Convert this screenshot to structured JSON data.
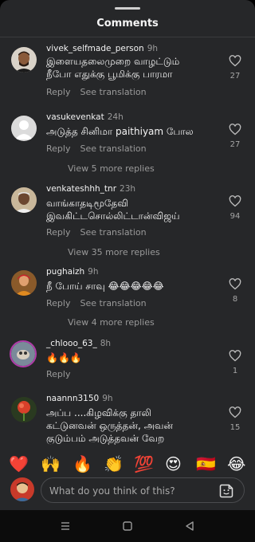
{
  "sheet": {
    "title": "Comments"
  },
  "comments": [
    {
      "user": "vivek_selfmade_person",
      "time": "9h",
      "text": "இளையதலைமுறை வாழட்டும்\nநீபோ எதுக்கு பூமிக்கு பாரமா",
      "reply": "Reply",
      "translate": "See translation",
      "likes": "27"
    },
    {
      "user": "vasukevenkat",
      "time": "24h",
      "text": "அடுத்த சினிமா paithiyam போல",
      "reply": "Reply",
      "translate": "See translation",
      "likes": "27",
      "more": "View 5 more replies"
    },
    {
      "user": "venkateshhh_tnr",
      "time": "23h",
      "text": "வாங்காதடிமூதேவி\nஇவகிட்டசொல்லிட்டான்விஜய்",
      "reply": "Reply",
      "translate": "See translation",
      "likes": "94",
      "more": "View 35 more replies"
    },
    {
      "user": "pughaizh",
      "time": "9h",
      "text": "நீ போய் சாவு 😂😂😂😂😂",
      "reply": "Reply",
      "translate": "See translation",
      "likes": "8",
      "more": "View 4 more replies"
    },
    {
      "user": "_chlooo_63_",
      "time": "8h",
      "text": "🔥🔥🔥",
      "reply": "Reply",
      "likes": "1"
    },
    {
      "user": "naannn3150",
      "time": "9h",
      "text": "அப்ப ....கிழவிக்கு தாலி\nகட்டுனவன் ஒருத்தன், அவன்\nகுடும்பம் அடுத்தவன் வேற",
      "likes": "15"
    }
  ],
  "reactions": [
    "❤️",
    "🙌",
    "🔥",
    "👏",
    "💯",
    "😍",
    "🇪🇸",
    "😂"
  ],
  "composer": {
    "placeholder": "What do you think of this?"
  },
  "icons": {
    "heart": "heart-outline-icon",
    "sticker": "sticker-icon",
    "nav": [
      "recents-icon",
      "home-icon",
      "back-icon"
    ]
  },
  "colors": {
    "sheet": "#262729",
    "muted": "#9a9a9a",
    "navbar": "#0c0c0c"
  }
}
